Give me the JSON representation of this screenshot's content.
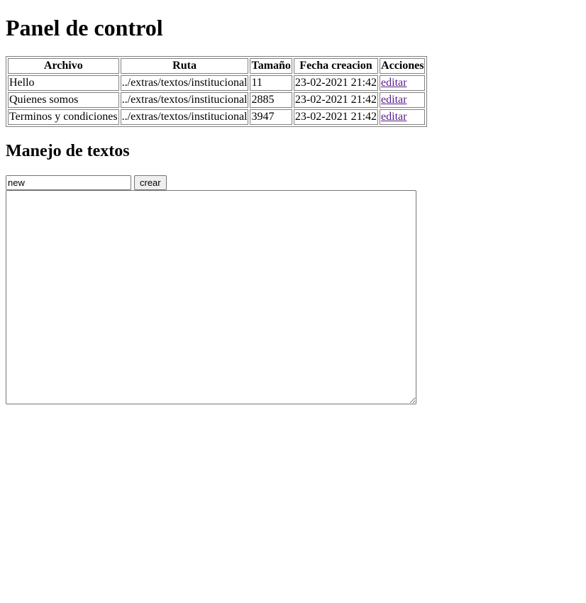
{
  "page": {
    "title": "Panel de control",
    "section_title": "Manejo de textos"
  },
  "table": {
    "headers": [
      "Archivo",
      "Ruta",
      "Tamaño",
      "Fecha creacion",
      "Acciones"
    ],
    "rows": [
      {
        "archivo": "Hello",
        "ruta": "../extras/textos/institucional",
        "tamano": "11",
        "fecha": "23-02-2021 21:42",
        "accion": "editar"
      },
      {
        "archivo": "Quienes somos",
        "ruta": "../extras/textos/institucional",
        "tamano": "2885",
        "fecha": "23-02-2021 21:42",
        "accion": "editar"
      },
      {
        "archivo": "Terminos y condiciones",
        "ruta": "../extras/textos/institucional",
        "tamano": "3947",
        "fecha": "23-02-2021 21:42",
        "accion": "editar"
      }
    ]
  },
  "form": {
    "name_value": "new",
    "create_label": "crear",
    "content_value": ""
  },
  "colors": {
    "link_visited": "#551a8b",
    "border": "#808080"
  }
}
